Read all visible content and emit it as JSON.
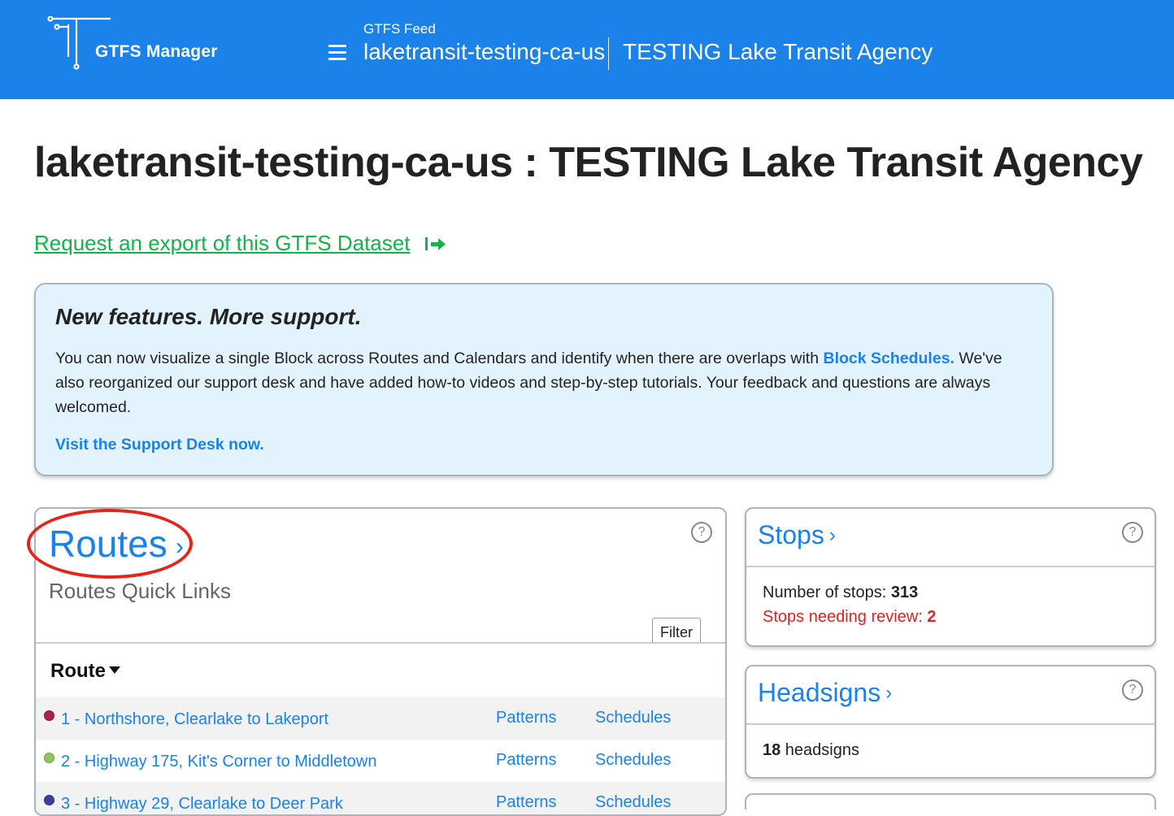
{
  "header": {
    "logo_text": "GTFS Manager",
    "feed_label": "GTFS Feed",
    "feed_id": "laketransit-testing-ca-us",
    "agency_name": "TESTING Lake Transit Agency",
    "brand_color": "#1a82e8"
  },
  "page": {
    "title": "laketransit-testing-ca-us : TESTING Lake Transit Agency",
    "export_link": "Request an export of this GTFS Dataset"
  },
  "banner": {
    "title": "New features. More support.",
    "body_text": "You can now visualize a single Block across Routes and Calendars and identify when there are overlaps with ",
    "body_link": "Block Schedules.",
    "body_text_2": " We've also reorganized our support desk and have added how-to videos and step-by-step tutorials. Your feedback and questions are always welcomed.",
    "cta": "Visit the Support Desk now."
  },
  "routes": {
    "title": "Routes",
    "subtitle": "Routes Quick Links",
    "help": "?",
    "filter_label": "Filter",
    "column_header": "Route",
    "items": [
      {
        "name": "1 - Northshore, Clearlake to Lakeport",
        "color": "#a8224a",
        "patterns": "Patterns",
        "schedules": "Schedules"
      },
      {
        "name": "2 - Highway 175, Kit's Corner to Middletown",
        "color": "#8fc45e",
        "patterns": "Patterns",
        "schedules": "Schedules"
      },
      {
        "name": "3 - Highway 29, Clearlake to Deer Park",
        "color": "#3a3f9e",
        "patterns": "Patterns",
        "schedules": "Schedules"
      }
    ]
  },
  "stops": {
    "title": "Stops",
    "help": "?",
    "count_label": "Number of stops: ",
    "count_value": "313",
    "review_label": "Stops needing review: ",
    "review_value": "2"
  },
  "headsigns": {
    "title": "Headsigns",
    "help": "?",
    "count_value": "18",
    "count_label": " headsigns"
  }
}
